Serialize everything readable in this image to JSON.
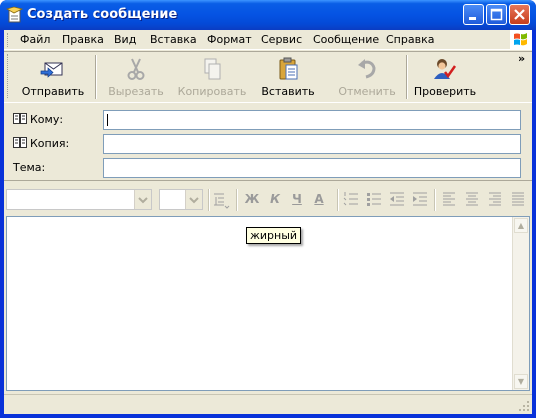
{
  "window": {
    "title": "Создать сообщение"
  },
  "menu": {
    "items": [
      "Файл",
      "Правка",
      "Вид",
      "Вставка",
      "Формат",
      "Сервис",
      "Сообщение",
      "Справка"
    ]
  },
  "toolbar": {
    "buttons": [
      {
        "label": "Отправить",
        "icon": "send-icon",
        "enabled": true
      },
      {
        "label": "Вырезать",
        "icon": "scissors-icon",
        "enabled": false
      },
      {
        "label": "Копировать",
        "icon": "copy-icon",
        "enabled": false
      },
      {
        "label": "Вставить",
        "icon": "clipboard-icon",
        "enabled": true
      },
      {
        "label": "Отменить",
        "icon": "undo-icon",
        "enabled": false
      },
      {
        "label": "Проверить",
        "icon": "check-names-icon",
        "enabled": true
      }
    ],
    "overflow": "»"
  },
  "header": {
    "to_label": "Кому:",
    "cc_label": "Копия:",
    "subject_label": "Тема:",
    "to_value": "",
    "cc_value": "",
    "subject_value": ""
  },
  "format": {
    "font_name": "",
    "font_size": "",
    "bold": "Ж",
    "italic": "К",
    "underline": "Ч",
    "font_color": "A"
  },
  "tooltip": {
    "text": "жирный"
  },
  "colors": {
    "titlebar": "#0553e3",
    "close": "#c63d1c",
    "client": "#ece9d8",
    "tooltip": "#ffffe1"
  }
}
